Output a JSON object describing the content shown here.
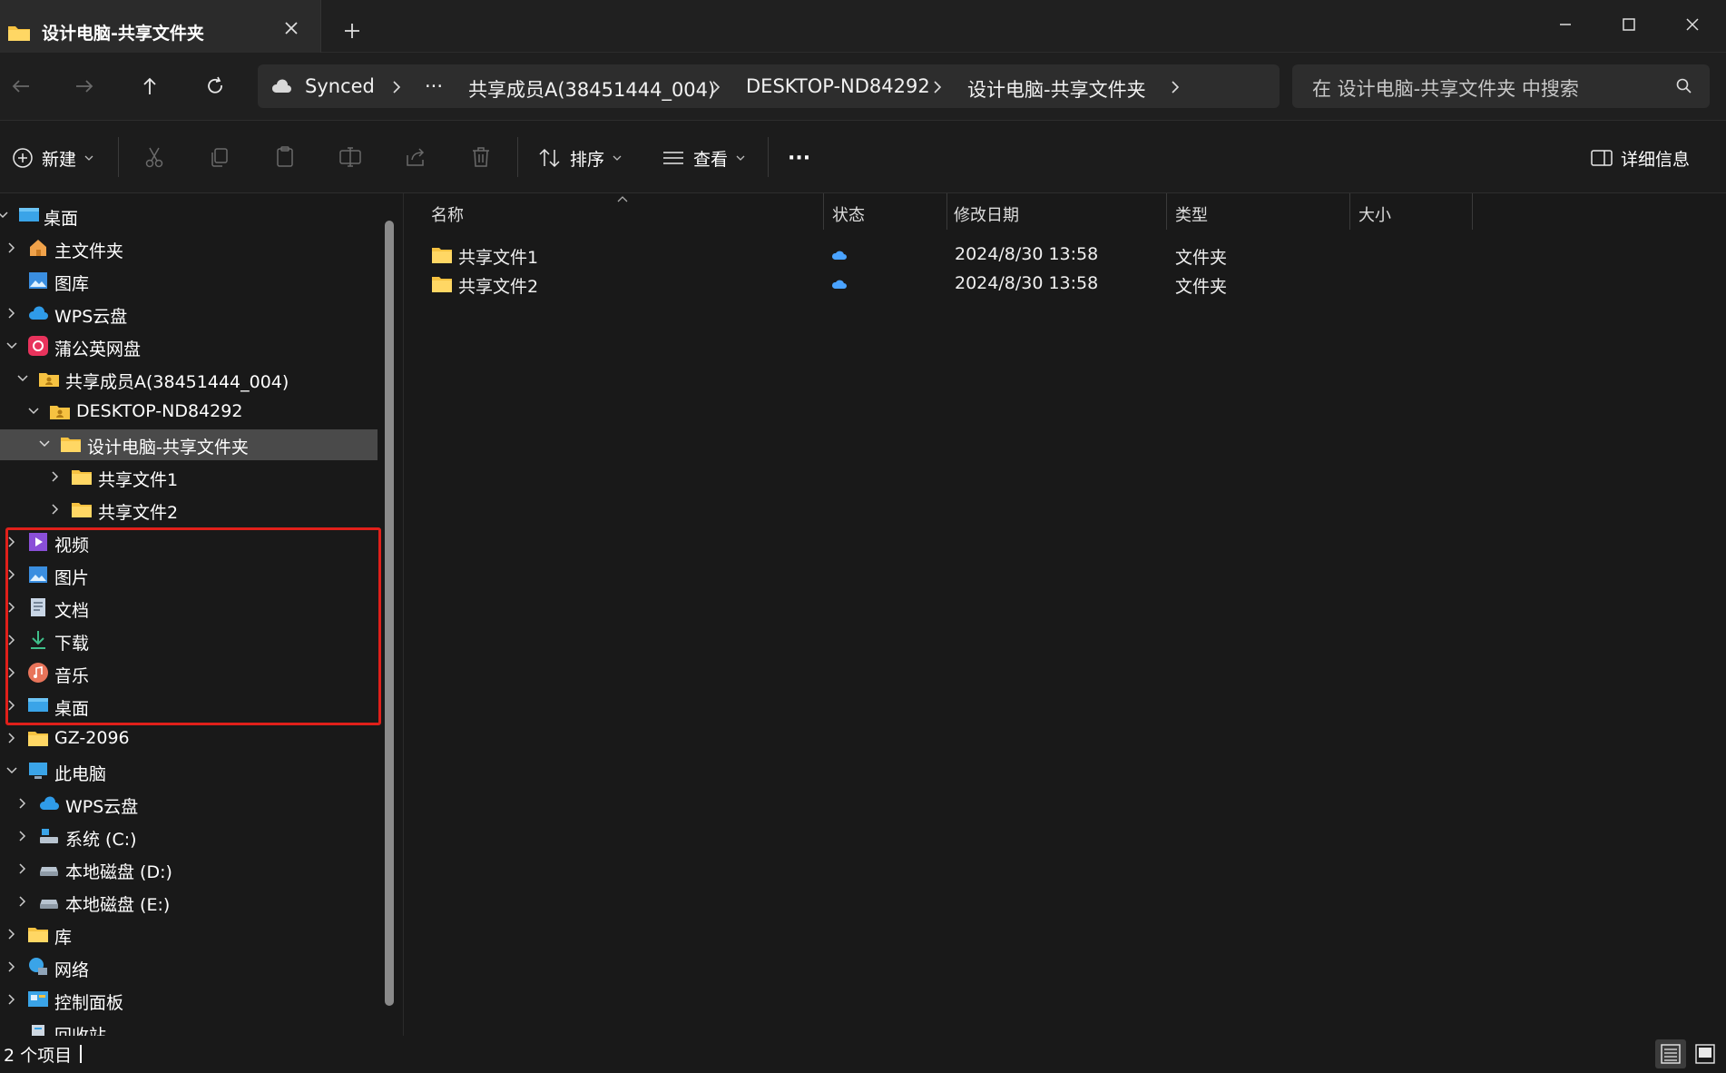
{
  "tab": {
    "title": "设计电脑-共享文件夹"
  },
  "breadcrumb": {
    "cloud_label": "Synced",
    "overflow": "···",
    "items": [
      "共享成员A(38451444_004)",
      "DESKTOP-ND84292",
      "设计电脑-共享文件夹"
    ]
  },
  "search": {
    "placeholder": "在 设计电脑-共享文件夹 中搜索"
  },
  "toolbar": {
    "new_label": "新建",
    "sort_label": "排序",
    "view_label": "查看",
    "more_label": "···",
    "details_label": "详细信息"
  },
  "nav": {
    "items": [
      {
        "label": "桌面",
        "icon": "desktop-icon",
        "expanded": true
      },
      {
        "label": "主文件夹",
        "icon": "home-icon"
      },
      {
        "label": "图库",
        "icon": "gallery-icon"
      },
      {
        "label": "WPS云盘",
        "icon": "cloud-icon"
      },
      {
        "label": "蒲公英网盘",
        "icon": "pgy-drive-icon",
        "expanded": true
      },
      {
        "label": "共享成员A(38451444_004)",
        "icon": "shared-folder-icon",
        "expanded": true
      },
      {
        "label": "DESKTOP-ND84292",
        "icon": "shared-folder-icon",
        "expanded": true
      },
      {
        "label": "设计电脑-共享文件夹",
        "icon": "folder-icon",
        "expanded": true,
        "selected": true
      },
      {
        "label": "共享文件1",
        "icon": "folder-icon"
      },
      {
        "label": "共享文件2",
        "icon": "folder-icon"
      },
      {
        "label": "视频",
        "icon": "video-icon"
      },
      {
        "label": "图片",
        "icon": "pictures-icon"
      },
      {
        "label": "文档",
        "icon": "documents-icon"
      },
      {
        "label": "下载",
        "icon": "download-icon"
      },
      {
        "label": "音乐",
        "icon": "music-icon"
      },
      {
        "label": "桌面",
        "icon": "desktop-icon"
      },
      {
        "label": "GZ-2096",
        "icon": "folder-icon"
      },
      {
        "label": "此电脑",
        "icon": "this-pc-icon",
        "expanded": true
      },
      {
        "label": "WPS云盘",
        "icon": "cloud-icon"
      },
      {
        "label": "系统 (C:)",
        "icon": "system-drive-icon"
      },
      {
        "label": "本地磁盘 (D:)",
        "icon": "drive-icon"
      },
      {
        "label": "本地磁盘 (E:)",
        "icon": "drive-icon"
      },
      {
        "label": "库",
        "icon": "library-icon"
      },
      {
        "label": "网络",
        "icon": "network-icon"
      },
      {
        "label": "控制面板",
        "icon": "control-panel-icon"
      },
      {
        "label": "回收站",
        "icon": "recycle-bin-icon"
      }
    ]
  },
  "columns": {
    "name": "名称",
    "status": "状态",
    "modified": "修改日期",
    "type": "类型",
    "size": "大小"
  },
  "files": [
    {
      "name": "共享文件1",
      "modified": "2024/8/30 13:58",
      "type": "文件夹",
      "size": ""
    },
    {
      "name": "共享文件2",
      "modified": "2024/8/30 13:58",
      "type": "文件夹",
      "size": ""
    }
  ],
  "status": {
    "count": "2 个项目"
  },
  "colors": {
    "accent": "#4aa3ff",
    "folder": "#f6c241",
    "highlight": "#e0201a",
    "selected_bg": "#4a4a4a"
  }
}
